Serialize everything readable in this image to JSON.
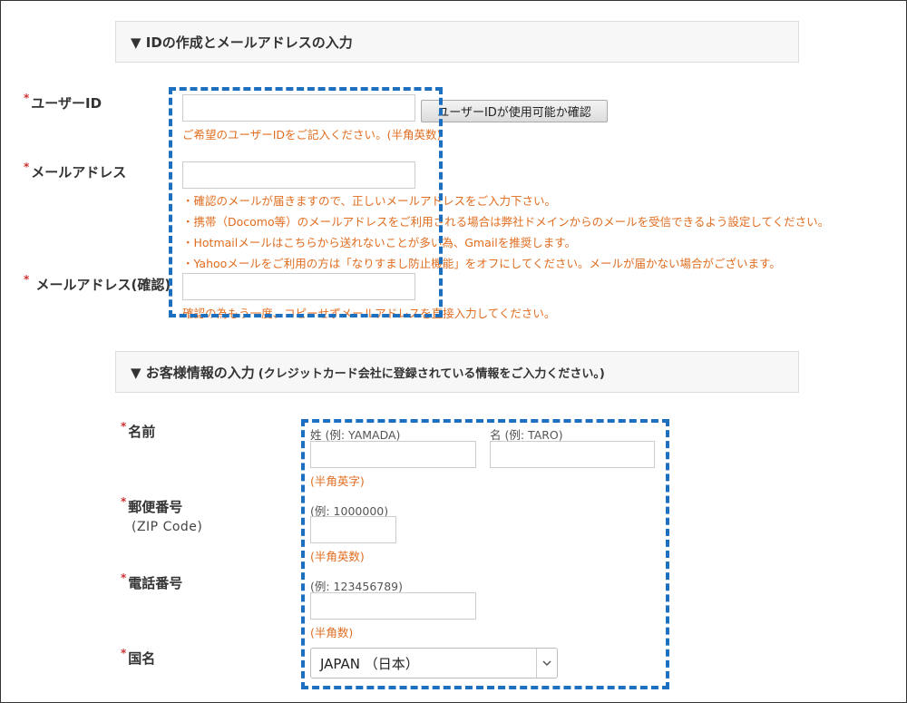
{
  "section1": {
    "title": "▼ IDの作成とメールアドレスの入力"
  },
  "user_id": {
    "label": "ユーザーID",
    "required_mark": "*",
    "value": "",
    "check_button": "ユーザーIDが使用可能か確認",
    "note": "ご希望のユーザーIDをご記入ください。(半角英数)"
  },
  "email": {
    "label": "メールアドレス",
    "required_mark": "*",
    "value": "",
    "notes": [
      "・確認のメールが届きますので、正しいメールアドレスをご入力下さい。",
      "・携帯（Docomo等）のメールアドレスをご利用される場合は弊社ドメインからのメールを受信できるよう設定してください。",
      "・Hotmailメールはこちらから送れないことが多い為、Gmailを推奨します。",
      "・Yahooメールをご利用の方は「なりすまし防止機能」をオフにしてください。メールが届かない場合がございます。"
    ]
  },
  "email_confirm": {
    "label": " メールアドレス(確認)",
    "required_mark": "*",
    "value": "",
    "note": "確認の為もう一度、コピーせずメールアドレスを直接入力してください。"
  },
  "section2": {
    "title": "▼ お客様情報の入力",
    "subtitle": "(クレジットカード会社に登録されている情報をご入力ください。)"
  },
  "name": {
    "label": "名前",
    "required_mark": "*",
    "last_hint": "姓 (例: YAMADA)",
    "first_hint": "名 (例: TARO)",
    "last_value": "",
    "first_value": "",
    "note": "(半角英字)"
  },
  "zip": {
    "label": "郵便番号",
    "required_mark": "*",
    "sublabel": "(ZIP Code)",
    "hint": "(例: 1000000)",
    "value": "",
    "note": "(半角英数)"
  },
  "phone": {
    "label": "電話番号",
    "required_mark": "*",
    "hint": "(例: 123456789)",
    "value": "",
    "note": "(半角数)"
  },
  "country": {
    "label": "国名",
    "required_mark": "*",
    "selected": "JAPAN （日本）"
  },
  "icons": {
    "select_arrow": "chevron-down-icon"
  },
  "colors": {
    "note": "#e06d20",
    "required": "#cc3333",
    "highlight_dash": "#1d6fbf"
  }
}
